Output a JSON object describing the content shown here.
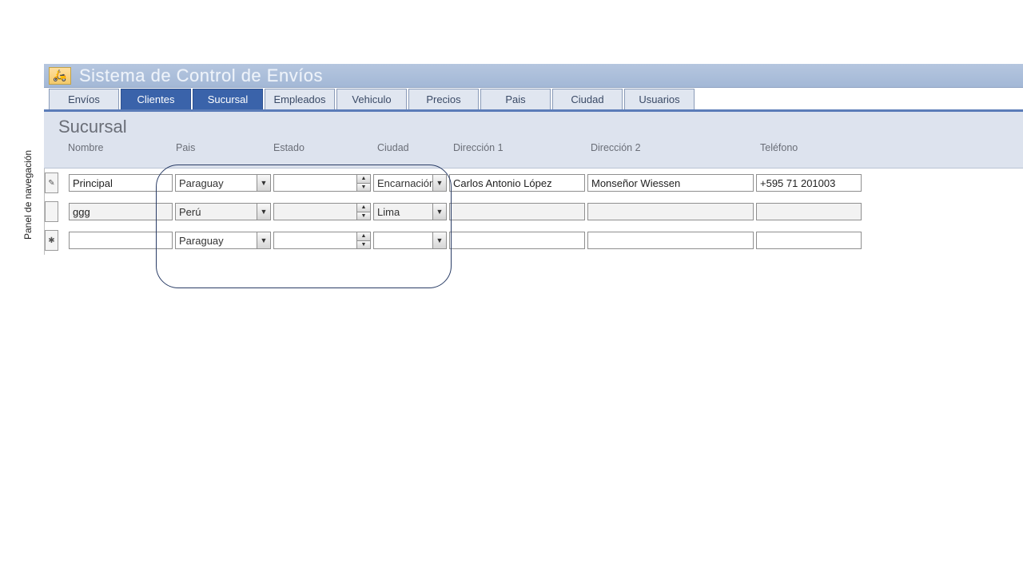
{
  "nav_panel_label": "Panel de navegación",
  "app_title": "Sistema de Control de Envíos",
  "tabs": [
    {
      "label": "Envíos",
      "active": false
    },
    {
      "label": "Clientes",
      "active": true
    },
    {
      "label": "Sucursal",
      "active": true
    },
    {
      "label": "Empleados",
      "active": false
    },
    {
      "label": "Vehiculo",
      "active": false
    },
    {
      "label": "Precios",
      "active": false
    },
    {
      "label": "Pais",
      "active": false
    },
    {
      "label": "Ciudad",
      "active": false
    },
    {
      "label": "Usuarios",
      "active": false
    }
  ],
  "subform": {
    "title": "Sucursal",
    "columns": [
      "Nombre",
      "Pais",
      "Estado",
      "Ciudad",
      "Dirección 1",
      "Dirección 2",
      "Teléfono"
    ],
    "rows": [
      {
        "selector": "edit",
        "nombre": "Principal",
        "pais": "Paraguay",
        "estado": "",
        "ciudad": "Encarnación",
        "direccion1": "Carlos Antonio López",
        "direccion2": "Monseñor Wiessen",
        "telefono": "+595 71 201003"
      },
      {
        "selector": "",
        "nombre": "ggg",
        "pais": "Perú",
        "estado": "",
        "ciudad": "Lima",
        "direccion1": "",
        "direccion2": "",
        "telefono": ""
      },
      {
        "selector": "new",
        "nombre": "",
        "pais": "Paraguay",
        "estado": "",
        "ciudad": "",
        "direccion1": "",
        "direccion2": "",
        "telefono": ""
      }
    ]
  },
  "icons": {
    "app": "🛵",
    "edit": "✎",
    "new": "✱",
    "down": "▼",
    "up": "▲"
  }
}
